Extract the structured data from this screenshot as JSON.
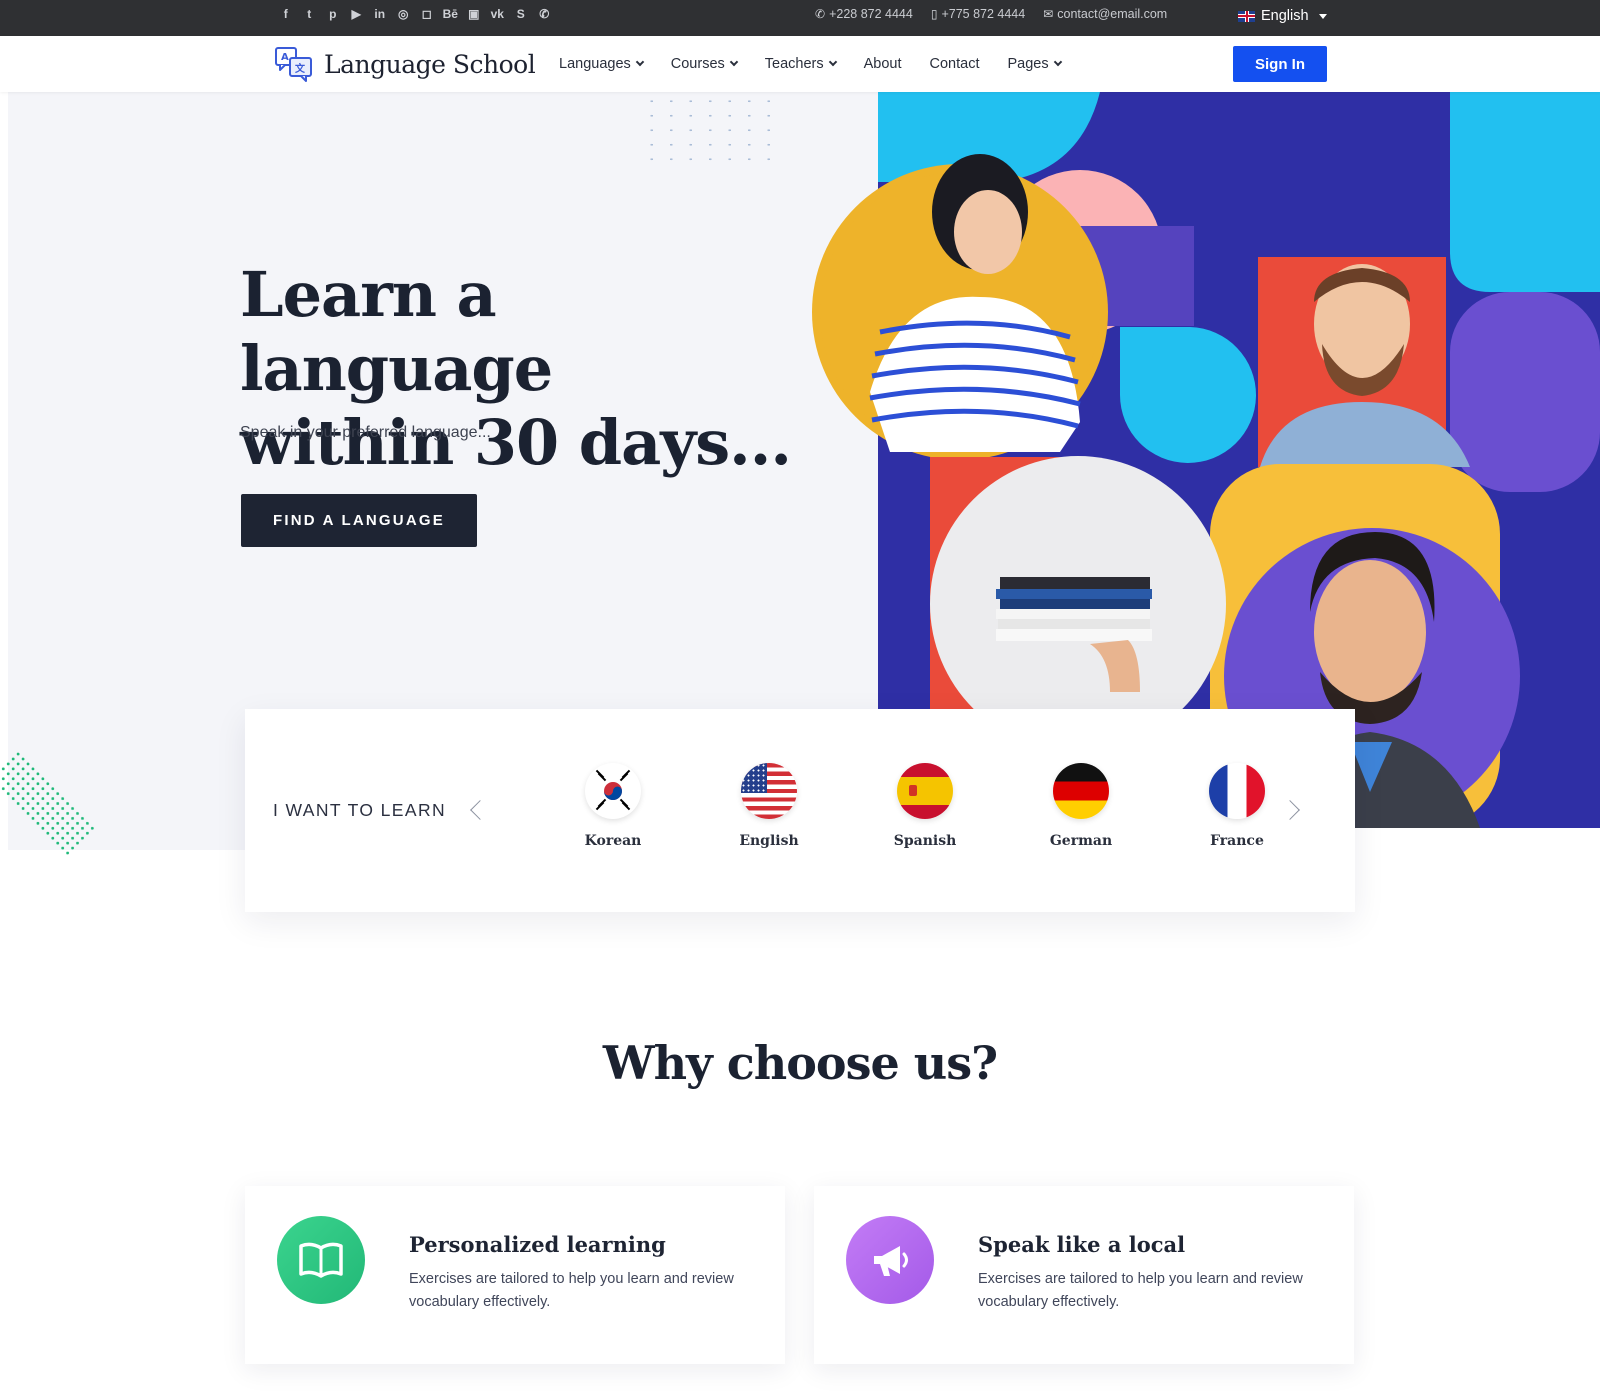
{
  "topbar": {
    "social": [
      "facebook-icon",
      "twitter-icon",
      "pinterest-icon",
      "youtube-icon",
      "linkedin-icon",
      "dribbble-icon",
      "instagram-icon",
      "behance-icon",
      "flickr-icon",
      "vk-icon",
      "skype-icon",
      "whatsapp-icon"
    ],
    "social_glyphs": [
      "f",
      "t",
      "p",
      "▶",
      "in",
      "◎",
      "◻",
      "Bē",
      "▣",
      "vk",
      "S",
      "✆"
    ],
    "phone": "+228 872 4444",
    "mobile": "+775 872 4444",
    "email": "contact@email.com",
    "language": "English"
  },
  "nav": {
    "logo_text": "Language School",
    "menu": [
      {
        "label": "Languages",
        "dropdown": true
      },
      {
        "label": "Courses",
        "dropdown": true
      },
      {
        "label": "Teachers",
        "dropdown": true
      },
      {
        "label": "About",
        "dropdown": false
      },
      {
        "label": "Contact",
        "dropdown": false
      },
      {
        "label": "Pages",
        "dropdown": true
      }
    ],
    "sign_in": "Sign In"
  },
  "hero": {
    "title_line1": "Learn a language",
    "title_line2": "within 30 days...",
    "subtitle": "Speak in your preferred language...",
    "cta": "FIND A LANGUAGE"
  },
  "language_picker": {
    "label": "I WANT TO LEARN",
    "languages": [
      "Korean",
      "English",
      "Spanish",
      "German",
      "France"
    ]
  },
  "why": {
    "title": "Why choose us?",
    "cards": [
      {
        "title": "Personalized learning",
        "text": "Exercises are tailored to help you learn and review vocabulary effectively.",
        "icon": "book-icon"
      },
      {
        "title": "Speak like a local",
        "text": "Exercises are tailored to help you learn and review vocabulary effectively.",
        "icon": "megaphone-icon"
      }
    ]
  },
  "colors": {
    "primary_button": "#1450f0",
    "dark": "#1e2433",
    "collage_blue": "#2f2fa5",
    "collage_cyan": "#22c0f0",
    "collage_orange": "#eeb32a",
    "collage_red": "#ea4b3a",
    "collage_purple": "#6a4fd0",
    "collage_pink": "#fbb3b5",
    "green_icon": "#2ec785",
    "purple_icon": "#b46cf0"
  }
}
